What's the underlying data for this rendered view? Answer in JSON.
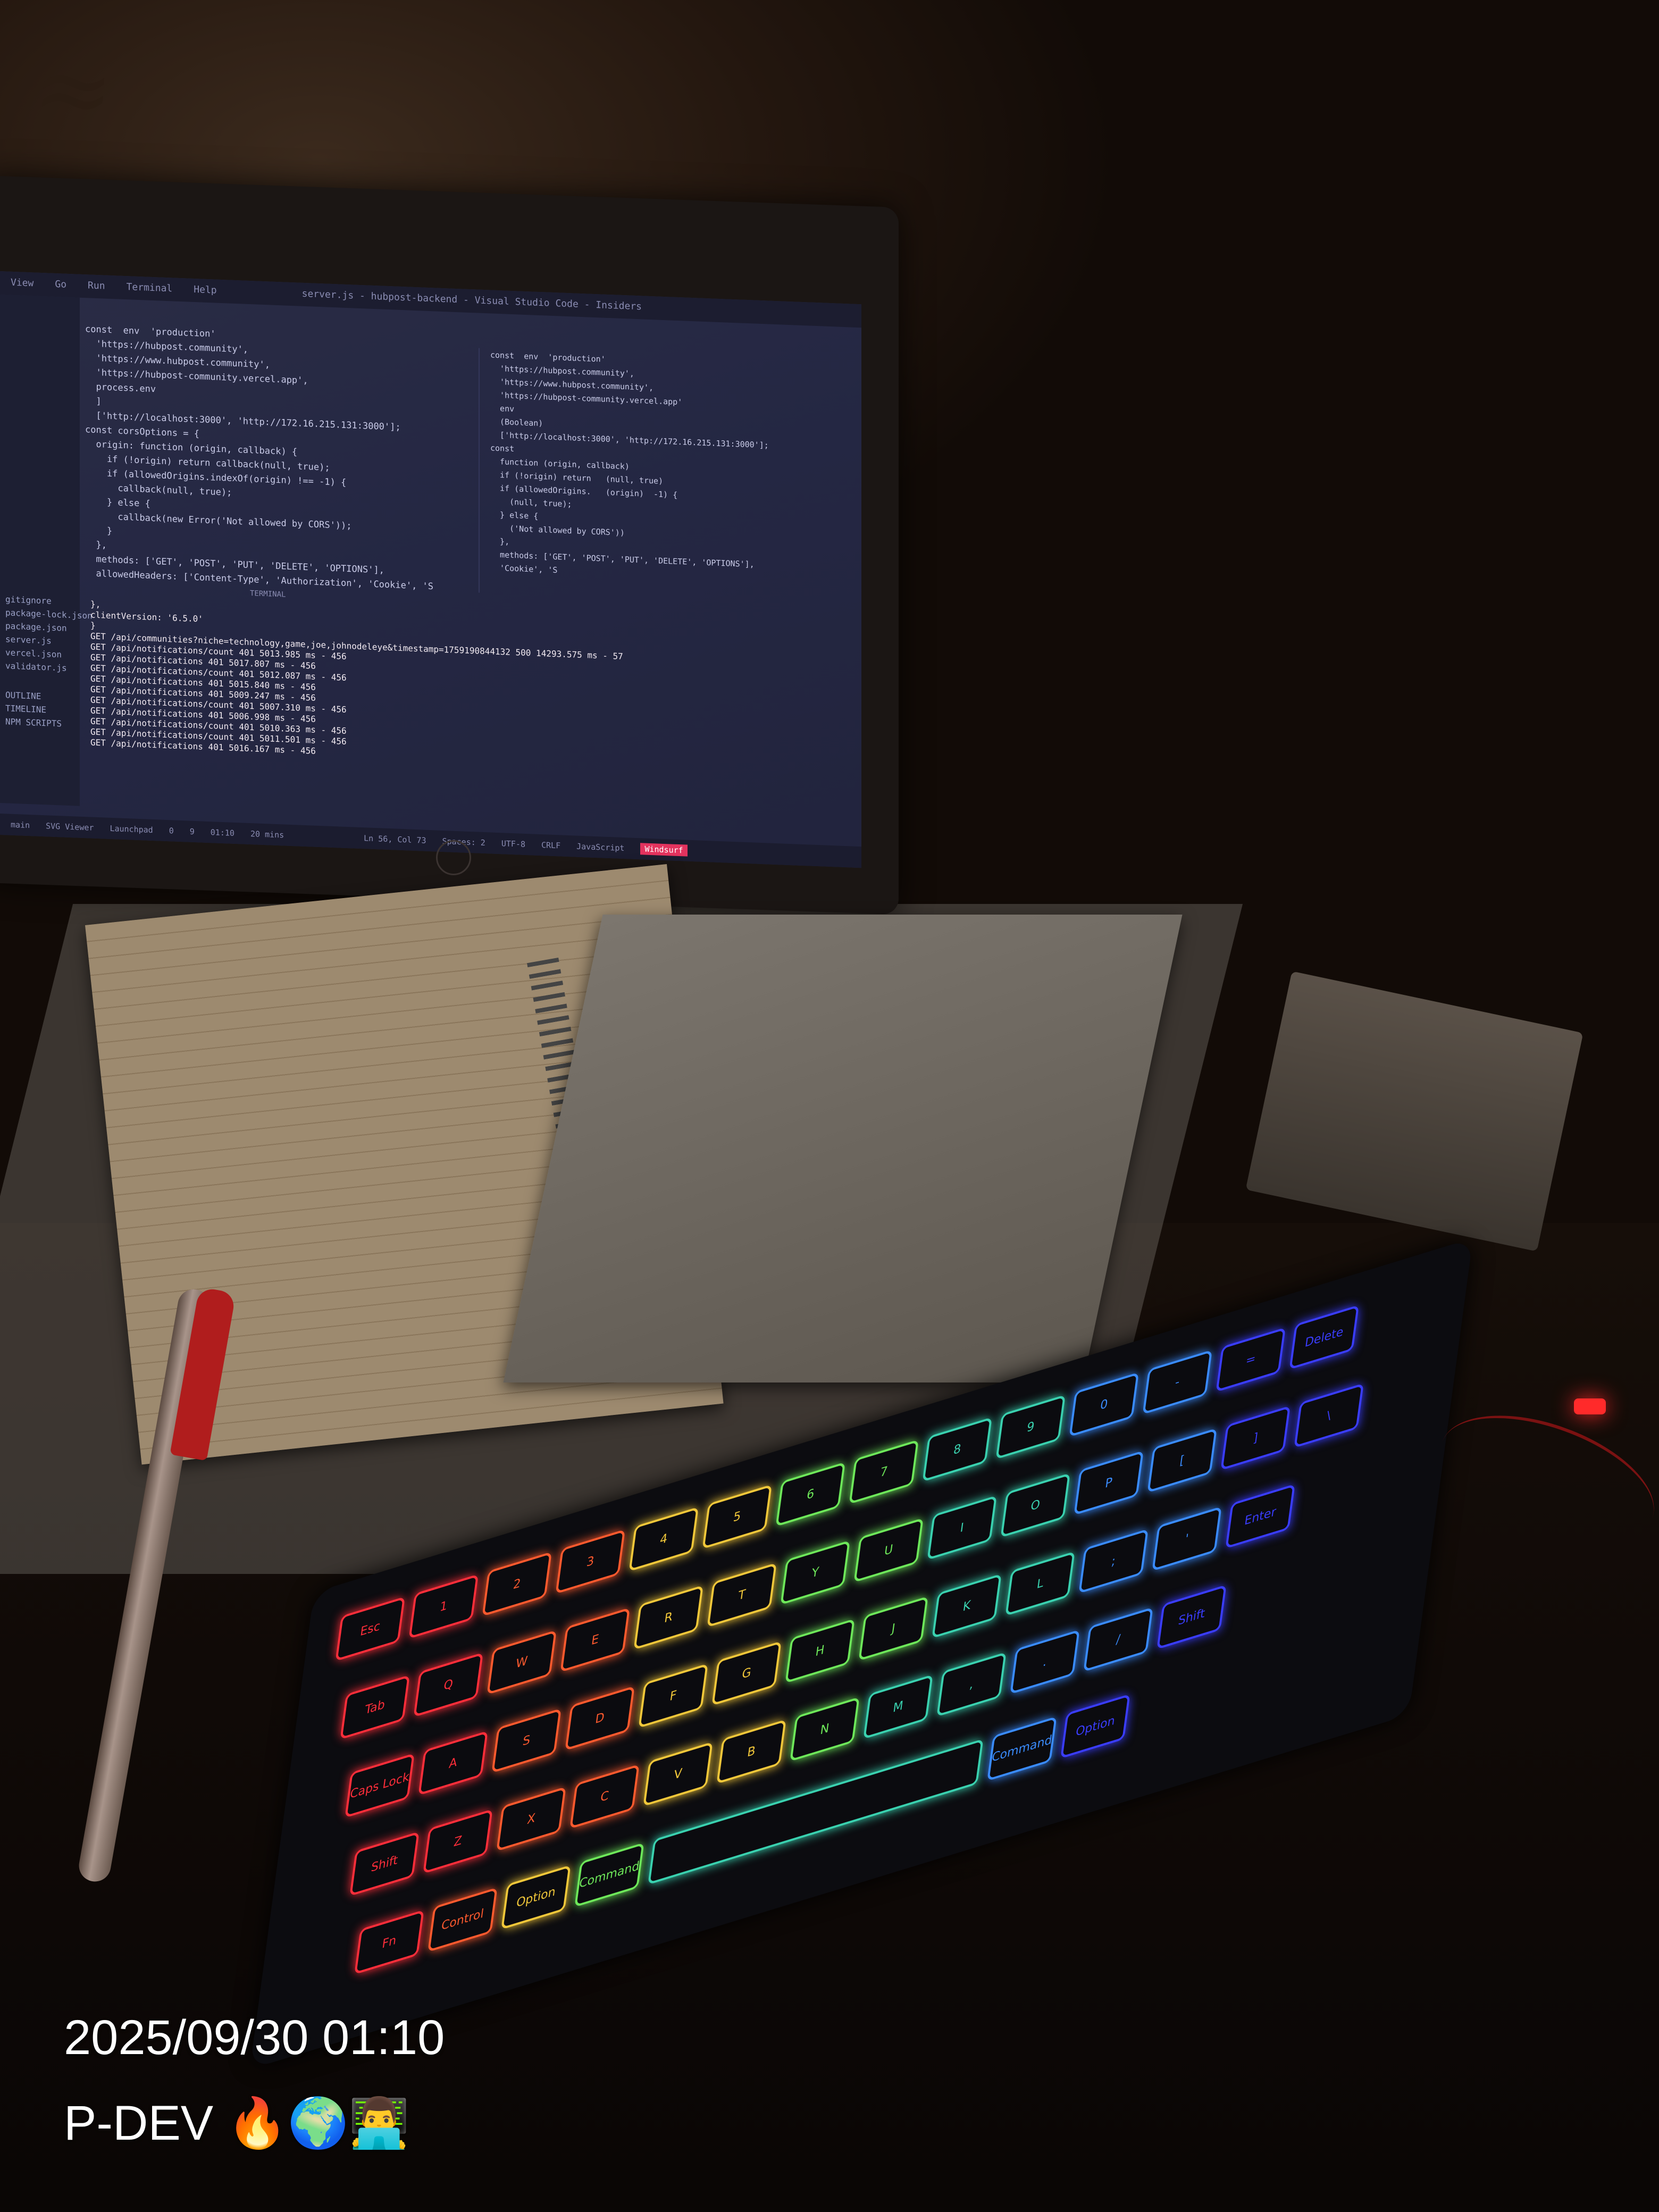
{
  "screen": {
    "menu": [
      "View",
      "Go",
      "Run",
      "Terminal",
      "Help"
    ],
    "title": "server.js - hubpost-backend - Visual Studio Code - Insiders",
    "files": [
      "gitignore",
      "package-lock.json",
      "package.json",
      "server.js",
      "vercel.json",
      "validator.js"
    ],
    "code_left": [
      "const  env  'production'",
      "  'https://hubpost.community',",
      "  'https://www.hubpost.community',",
      "  'https://hubpost-community.vercel.app',",
      "  process.env",
      "  ]",
      "  ['http://localhost:3000', 'http://172.16.215.131:3000'];",
      "const corsOptions = {",
      "  origin: function (origin, callback) {",
      "    if (!origin) return callback(null, true);",
      "    if (allowedOrigins.indexOf(origin) !== -1) {",
      "      callback(null, true);",
      "    } else {",
      "      callback(new Error('Not allowed by CORS'));",
      "    }",
      "  },",
      "  methods: ['GET', 'POST', 'PUT', 'DELETE', 'OPTIONS'],",
      "  allowedHeaders: ['Content-Type', 'Authorization', 'Cookie', 'S"
    ],
    "code_right": [
      "const  env  'production'",
      "  'https://hubpost.community',",
      "  'https://www.hubpost.community',",
      "  'https://hubpost-community.vercel.app'",
      "  env",
      "  (Boolean)",
      "  ['http://localhost:3000', 'http://172.16.215.131:3000'];",
      "const",
      "  function (origin, callback)",
      "  if (!origin) return   (null, true)",
      "  if (allowedOrigins.   (origin)  -1) {",
      "    (null, true);",
      "  } else {",
      "    ('Not allowed by CORS'))",
      "  },",
      "  methods: ['GET', 'POST', 'PUT', 'DELETE', 'OPTIONS'],",
      "  'Cookie', 'S"
    ],
    "terminal_label": "TERMINAL",
    "terminal": [
      "},",
      "clientVersion: '6.5.0'",
      "}",
      "GET /api/communities?niche=technology,game,joe,johnodeleye&timestamp=1759190844132 500 14293.575 ms - 57",
      "GET /api/notifications/count 401 5013.985 ms - 456",
      "GET /api/notifications 401 5017.807 ms - 456",
      "GET /api/notifications/count 401 5012.087 ms - 456",
      "GET /api/notifications 401 5015.840 ms - 456",
      "GET /api/notifications 401 5009.247 ms - 456",
      "GET /api/notifications/count 401 5007.310 ms - 456",
      "GET /api/notifications 401 5006.998 ms - 456",
      "GET /api/notifications/count 401 5010.363 ms - 456",
      "GET /api/notifications/count 401 5011.501 ms - 456",
      "GET /api/notifications 401 5016.167 ms - 456"
    ],
    "status_left": [
      "main",
      "SVG Viewer",
      "Launchpad",
      "0",
      "9",
      "01:10",
      "20 mins"
    ],
    "status_right": [
      "Ln 56, Col 73",
      "Spaces: 2",
      "UTF-8",
      "CRLF",
      "JavaScript",
      "Windsurf"
    ],
    "sidebar_labels": [
      "OUTLINE",
      "TIMELINE",
      "NPM SCRIPTS"
    ]
  },
  "overlay": {
    "timestamp": "2025/09/30 01:10",
    "caption": "P-DEV 🔥🌍👨‍💻"
  },
  "keyboard": {
    "rows": [
      [
        "Esc",
        "1",
        "2",
        "3",
        "4",
        "5",
        "6",
        "7",
        "8",
        "9",
        "0",
        "-",
        "=",
        "Delete"
      ],
      [
        "Tab",
        "Q",
        "W",
        "E",
        "R",
        "T",
        "Y",
        "U",
        "I",
        "O",
        "P",
        "[",
        "]",
        "\\"
      ],
      [
        "Caps Lock",
        "A",
        "S",
        "D",
        "F",
        "G",
        "H",
        "J",
        "K",
        "L",
        ";",
        "'",
        "Enter"
      ],
      [
        "Shift",
        "Z",
        "X",
        "C",
        "V",
        "B",
        "N",
        "M",
        ",",
        ".",
        "/",
        "Shift"
      ],
      [
        "Fn",
        "Control",
        "Option",
        "Command",
        "",
        "Command",
        "Option"
      ]
    ]
  },
  "colors": {
    "key_gradient": [
      "#ff2e3a",
      "#ff5a2e",
      "#f2c83a",
      "#6ee85a",
      "#3ad2b0",
      "#3a8cff",
      "#3a3dff"
    ]
  }
}
